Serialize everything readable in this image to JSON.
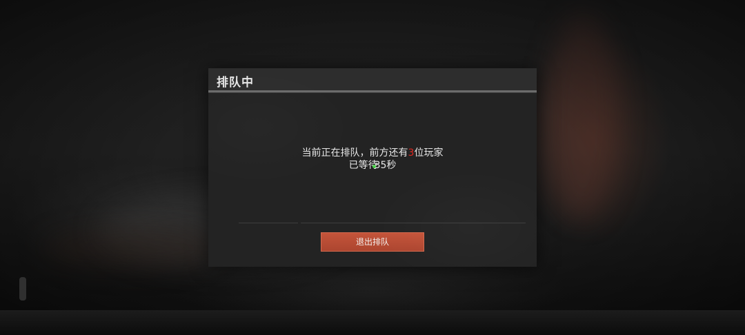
{
  "dialog": {
    "title": "排队中",
    "queue_text_before": "当前正在排队，前方还有",
    "players_ahead": "3",
    "queue_text_after": "位玩家",
    "wait_prefix": "已等待",
    "wait_seconds": "35",
    "wait_suffix": "秒",
    "exit_button_label": "退出排队"
  },
  "colors": {
    "players_ahead": "#e0261e",
    "exit_button": "#b84c34",
    "loading_indicator": "#4ad04a"
  },
  "icons": {
    "loading": "loading-dot-icon"
  }
}
